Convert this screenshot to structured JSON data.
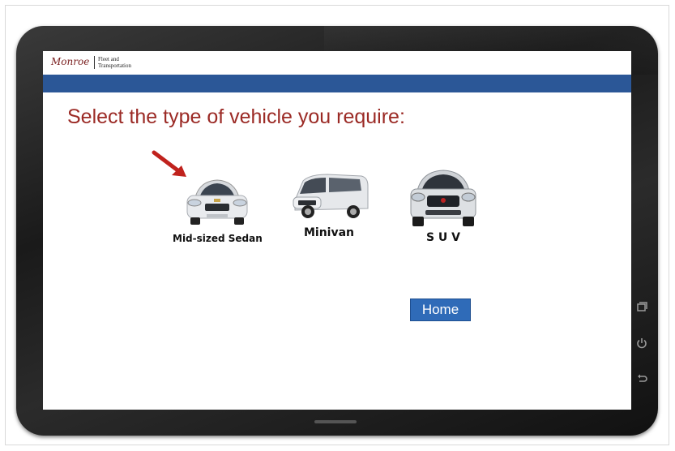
{
  "header": {
    "logo_text": "Monroe",
    "subtitle_line1": "Fleet and",
    "subtitle_line2": "Transportation"
  },
  "main": {
    "prompt": "Select the type of vehicle you require:",
    "vehicles": [
      {
        "label": "Mid-sized Sedan"
      },
      {
        "label": "Minivan"
      },
      {
        "label": "S U V"
      }
    ],
    "home_label": "Home"
  },
  "device": {
    "icons": [
      "recent-apps-icon",
      "power-icon",
      "back-icon"
    ]
  },
  "colors": {
    "accent_blue": "#2b5797",
    "prompt_red": "#9b2a25",
    "button_blue": "#2f6bb8"
  }
}
